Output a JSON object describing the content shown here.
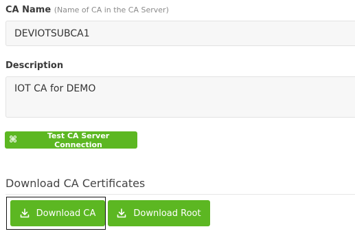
{
  "ca_name": {
    "label": "CA Name",
    "hint": "(Name of CA in the CA Server)",
    "value": "DEVIOTSUBCA1"
  },
  "description": {
    "label": "Description",
    "value": "IOT CA for DEMO"
  },
  "test_connection": {
    "label": "Test CA Server Connection",
    "icon": "command-icon"
  },
  "download_section": {
    "title": "Download CA Certificates",
    "download_ca_label": "Download CA",
    "download_root_label": "Download Root",
    "icon": "download-icon"
  },
  "colors": {
    "button_green": "#5cb722",
    "input_bg": "#f7f7f7",
    "input_border": "#e2e2e2"
  }
}
